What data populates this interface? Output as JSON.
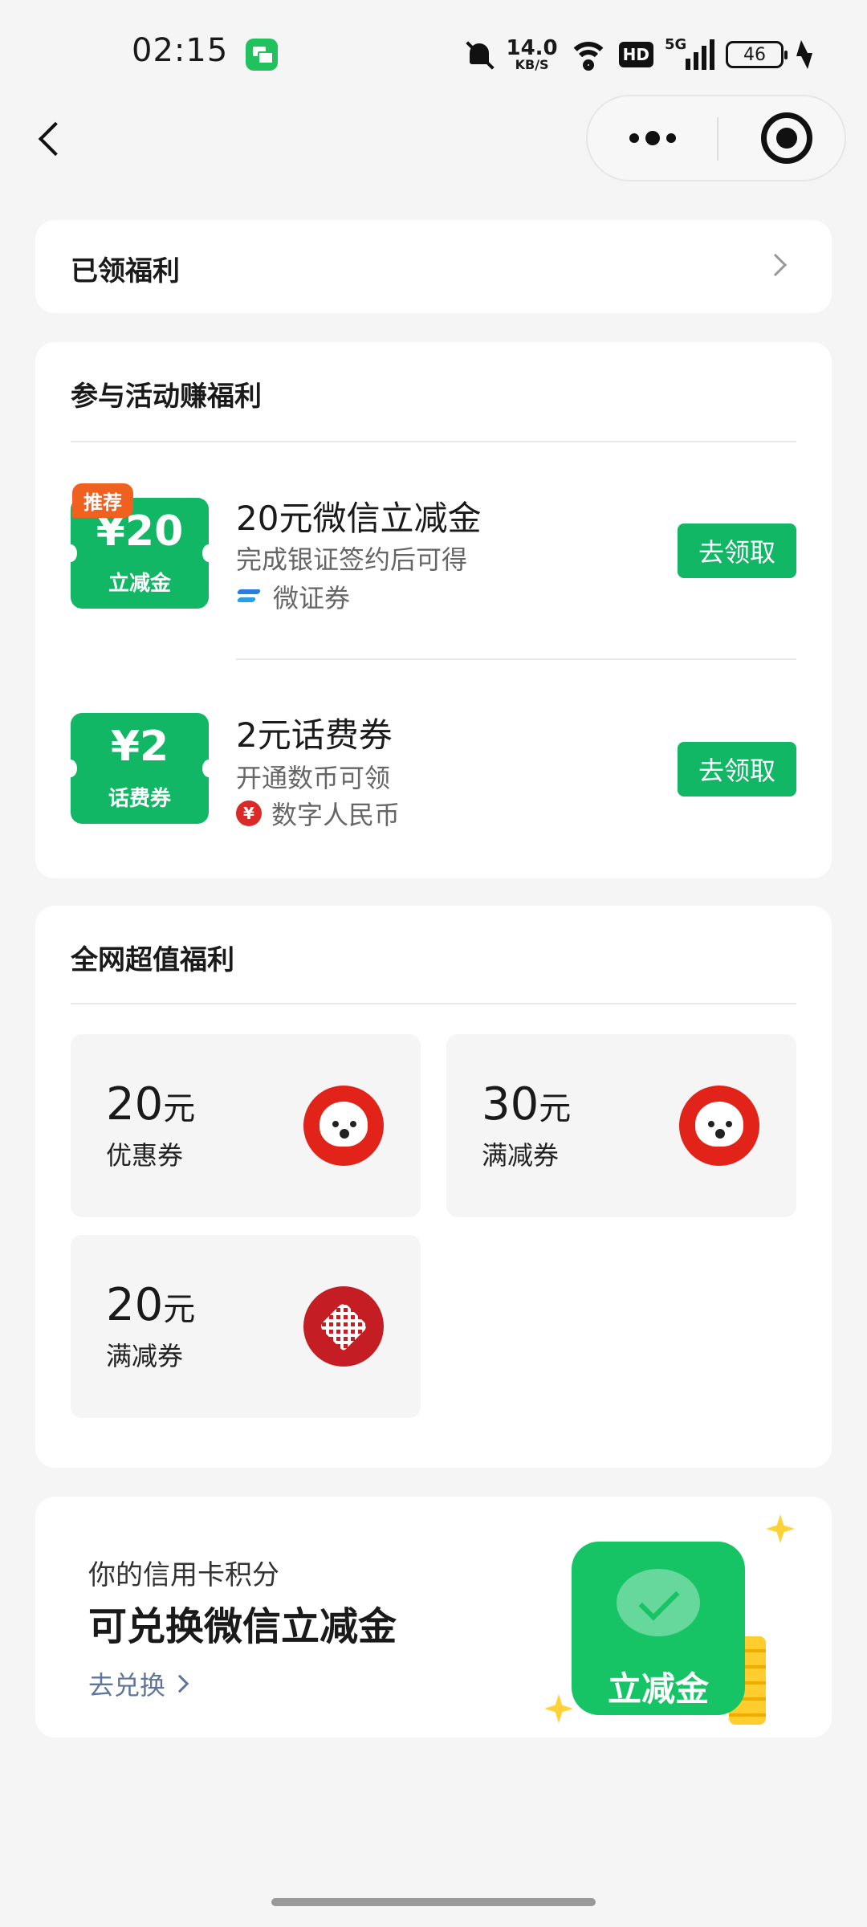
{
  "status_bar": {
    "time": "02:15",
    "net_speed_value": "14.0",
    "net_speed_unit": "KB/S",
    "hd_label": "HD",
    "network_label": "5G",
    "battery": "46"
  },
  "nav": {
    "back_icon": "chevron-left-icon",
    "more_icon": "more-dots-icon",
    "close_icon": "target-circle-icon"
  },
  "claimed": {
    "label": "已领福利"
  },
  "events": {
    "title": "参与活动赚福利",
    "items": [
      {
        "badge": "推荐",
        "ticket_amount": "¥20",
        "ticket_label": "立减金",
        "title": "20元微信立减金",
        "subtitle": "完成银证签约后可得",
        "source": "微证券",
        "button": "去领取"
      },
      {
        "ticket_amount": "¥2",
        "ticket_label": "话费券",
        "title": "2元话费券",
        "subtitle": "开通数币可领",
        "source": "数字人民币",
        "source_glyph": "¥",
        "button": "去领取"
      }
    ]
  },
  "deals": {
    "title": "全网超值福利",
    "items": [
      {
        "amount": "20",
        "unit": "元",
        "type": "优惠券",
        "logo": "jd-mascot-icon"
      },
      {
        "amount": "30",
        "unit": "元",
        "type": "满减券",
        "logo": "jd-mascot-icon"
      },
      {
        "amount": "20",
        "unit": "元",
        "type": "满减券",
        "logo": "pinduoduo-heart-icon"
      }
    ]
  },
  "promo": {
    "line1": "你的信用卡积分",
    "line2": "可兑换微信立减金",
    "link": "去兑换",
    "card_text": "立减金"
  },
  "colors": {
    "accent_green": "#12b765",
    "badge_orange": "#f0601e",
    "link_blue_gray": "#5f7599",
    "jd_red": "#e2231a"
  }
}
